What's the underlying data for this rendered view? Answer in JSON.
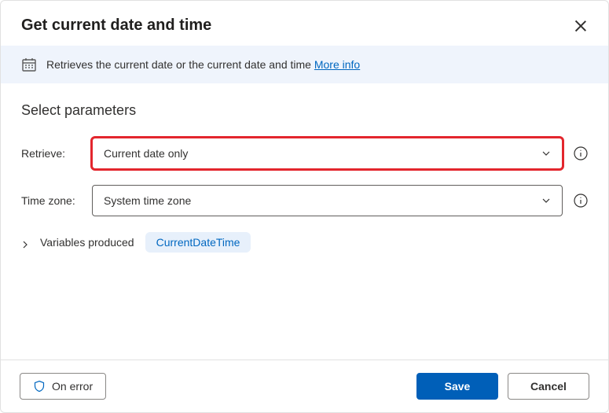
{
  "dialog": {
    "title": "Get current date and time",
    "description": "Retrieves the current date or the current date and time",
    "more_info_label": "More info"
  },
  "section_title": "Select parameters",
  "parameters": {
    "retrieve": {
      "label": "Retrieve:",
      "value": "Current date only"
    },
    "timezone": {
      "label": "Time zone:",
      "value": "System time zone"
    }
  },
  "variables_produced": {
    "label": "Variables produced",
    "chip": "CurrentDateTime"
  },
  "footer": {
    "on_error": "On error",
    "save": "Save",
    "cancel": "Cancel"
  }
}
